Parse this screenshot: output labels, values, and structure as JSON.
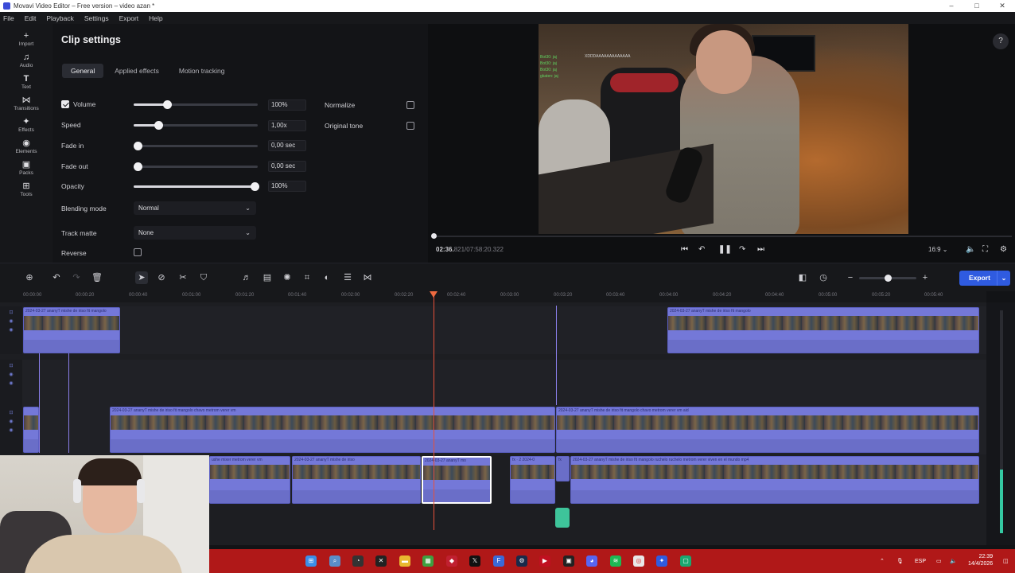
{
  "window": {
    "title": "Movavi Video Editor – Free version – video azan *",
    "controls": [
      "–",
      "□",
      "✕"
    ]
  },
  "menu": [
    "File",
    "Edit",
    "Playback",
    "Settings",
    "Export",
    "Help"
  ],
  "rail": [
    {
      "label": "Import",
      "icon": "plus-icon"
    },
    {
      "label": "Audio",
      "icon": "music-icon"
    },
    {
      "label": "Text",
      "icon": "text-icon"
    },
    {
      "label": "Transitions",
      "icon": "transitions-icon"
    },
    {
      "label": "Effects",
      "icon": "effects-icon"
    },
    {
      "label": "Elements",
      "icon": "elements-icon"
    },
    {
      "label": "Packs",
      "icon": "packs-icon"
    },
    {
      "label": "Tools",
      "icon": "tools-icon"
    }
  ],
  "clip_settings": {
    "title": "Clip settings",
    "tabs": [
      "General",
      "Applied effects",
      "Motion tracking"
    ],
    "volume": {
      "label": "Volume",
      "value": "100%",
      "level": 0.25
    },
    "speed": {
      "label": "Speed",
      "value": "1,00x",
      "level": 0.19
    },
    "fade_in": {
      "label": "Fade in",
      "value": "0,00 sec",
      "level": 0.0
    },
    "fade_out": {
      "label": "Fade out",
      "value": "0,00 sec",
      "level": 0.0
    },
    "opacity": {
      "label": "Opacity",
      "value": "100%",
      "level": 1.0
    },
    "blending_mode": {
      "label": "Blending mode",
      "value": "Normal"
    },
    "track_matte": {
      "label": "Track matte",
      "value": "None"
    },
    "reverse": {
      "label": "Reverse"
    },
    "normalize": {
      "label": "Normalize"
    },
    "original_tone": {
      "label": "Original tone"
    }
  },
  "preview": {
    "timecode_current": "02:36.",
    "timecode_rest": "821/07:58:20.322",
    "aspect": "16:9",
    "chat_lines": [
      "Bot30: jaj",
      "Bot30: jaj",
      "Bot30: jaj",
      "gkaten: jaj"
    ],
    "overlay_text": "XDDDAAAAAAAAAAAAA"
  },
  "ruler": [
    "00:00:00",
    "00:00:20",
    "00:00:40",
    "00:01:00",
    "00:01:20",
    "00:01:40",
    "00:02:00",
    "00:02:20",
    "00:02:40",
    "00:03:00",
    "00:03:20",
    "00:03:40",
    "00:04:00",
    "00:04:20",
    "00:04:40",
    "00:05:00",
    "00:05:20",
    "00:05:40"
  ],
  "clips": {
    "c1": "2024-03-27 ananyT mishe de iriso fit mangolo",
    "c2": "2024-03-27 ananyT mishe de iriso fit mangolo",
    "c3": "2024-03-27 ananyT mishe de iriso fit mangolo chavo metrom verer vm",
    "c4": "2024-03-27 ananyT mishe de iriso fit mangolo chavo metrom verer vm aid",
    "c5": "ushe mixer metrom verer vm",
    "c6": "2024-03-27 ananyT mishe de iriso",
    "c7": "2024-03-27 ananyT mo",
    "c8": "fx · 2   2024-0",
    "c9": "fx",
    "c10": "2024-03-27 ananyT mishe de iriso fit mangolo ruchelo ruchelo metrom verer viven en el mundo mp4"
  },
  "toolbar": {
    "export_label": "Export"
  },
  "taskbar": {
    "lang": "ESP",
    "time": "22:39",
    "date": "14/4/2026"
  },
  "colors": {
    "accent": "#2f5be0",
    "clip": "#7478d8",
    "playhead": "#e8503a",
    "taskbar": "#b01818"
  }
}
